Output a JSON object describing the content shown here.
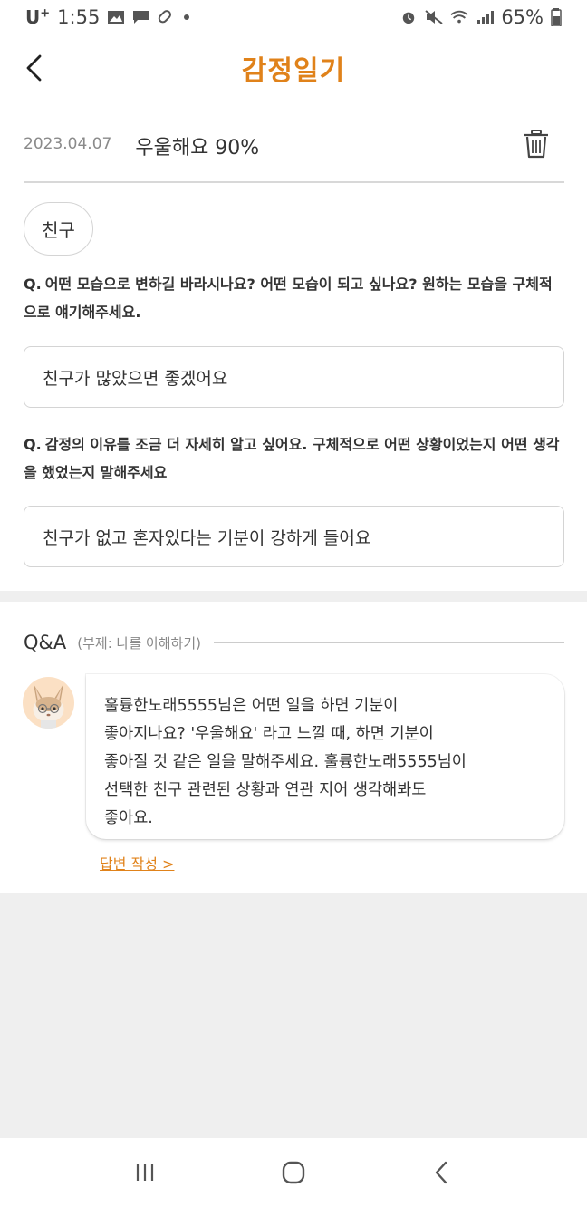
{
  "status_bar": {
    "carrier": "U",
    "carrier_plus": "+",
    "time": "1:55",
    "battery": "65%",
    "icons": [
      "image-icon",
      "message-icon",
      "pill-icon",
      "dot-icon",
      "alarm-icon",
      "mute-icon",
      "wifi-icon",
      "signal-icon",
      "battery-icon"
    ]
  },
  "app_bar": {
    "title": "감정일기",
    "title_color": "#e0821a",
    "back_icon": "chevron-left-icon"
  },
  "entry": {
    "date": "2023.04.07",
    "mood": "우울해요 90%",
    "delete_icon": "trash-icon",
    "tag": "친구",
    "qa": [
      {
        "q_prefix": "Q.",
        "question": "어떤 모습으로 변하길 바라시나요? 어떤 모습이 되고 싶나요? 원하는 모습을 구체적으로 얘기해주세요.",
        "answer": "친구가 많았으면 좋겠어요"
      },
      {
        "q_prefix": "Q.",
        "question": "감정의 이유를 조금 더 자세히 알고 싶어요. 구체적으로 어떤 상황이었는지 어떤 생각을 했었는지 말해주세요",
        "answer": "친구가 없고 혼자있다는 기분이 강하게 들어요"
      }
    ]
  },
  "qa_section": {
    "title": "Q&A",
    "subtitle": "(부제: 나를 이해하기)",
    "message": "훌륭한노래5555님은 어떤 일을 하면 기분이\n좋아지나요? '우울해요' 라고 느낄 때, 하면 기분이\n좋아질 것 같은 일을 말해주세요. 훌륭한노래5555님이\n선택한 친구 관련된 상황과 연관 지어 생각해봐도\n좋아요.",
    "reply_link": "답변 작성 >",
    "avatar_icon": "fox-avatar-icon"
  },
  "nav_bar": {
    "icons": [
      "recent-apps-icon",
      "home-icon",
      "back-icon"
    ]
  }
}
